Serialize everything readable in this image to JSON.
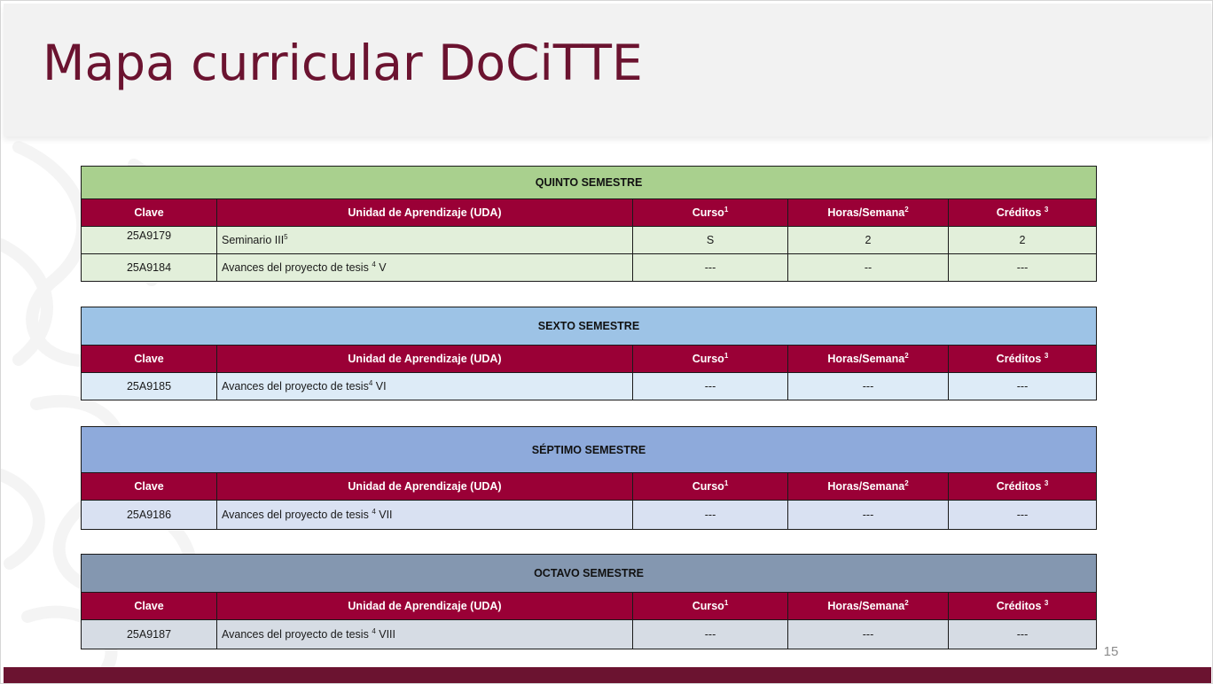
{
  "slide": {
    "title": "Mapa curricular DoCiTTE",
    "page_number": "15"
  },
  "columns": {
    "clave": "Clave",
    "uda": "Unidad de Aprendizaje (UDA)",
    "curso": "Curso",
    "curso_sup": "1",
    "horas": "Horas/Semana",
    "horas_sup": "2",
    "creditos": "Créditos ",
    "creditos_sup": "3"
  },
  "semesters": [
    {
      "title": "QUINTO SEMESTRE",
      "rows": [
        {
          "clave": "25A9179",
          "uda": "Seminario III",
          "uda_sup": "5",
          "uda_suffix": "",
          "curso": "S",
          "horas": "2",
          "creditos": "2"
        },
        {
          "clave": "25A9184",
          "uda": "Avances del proyecto de tesis ",
          "uda_sup": "4",
          "uda_suffix": " V",
          "curso": "---",
          "horas": "--",
          "creditos": "---"
        }
      ]
    },
    {
      "title": "SEXTO SEMESTRE",
      "rows": [
        {
          "clave": "25A9185",
          "uda": "Avances del proyecto de tesis",
          "uda_sup": "4",
          "uda_suffix": " VI",
          "curso": "---",
          "horas": "---",
          "creditos": "---"
        }
      ]
    },
    {
      "title": "SÉPTIMO SEMESTRE",
      "rows": [
        {
          "clave": "25A9186",
          "uda": "Avances del proyecto de tesis ",
          "uda_sup": "4",
          "uda_suffix": " VII",
          "curso": "---",
          "horas": "---",
          "creditos": "---"
        }
      ]
    },
    {
      "title": "OCTAVO SEMESTRE",
      "rows": [
        {
          "clave": "25A9187",
          "uda": "Avances del proyecto de tesis ",
          "uda_sup": "4",
          "uda_suffix": " VIII",
          "curso": "---",
          "horas": "---",
          "creditos": "---"
        }
      ]
    }
  ],
  "colors": {
    "title": "#6b1330",
    "header_row": "#9a0036",
    "footer_band": "#6b1330",
    "quinto_title": "#a9d08e",
    "quinto_rows": "#e2efda",
    "sexto_title": "#9dc3e6",
    "sexto_rows": "#ddebf7",
    "septimo_title": "#8eaadb",
    "septimo_rows": "#d9e1f2",
    "octavo_title": "#8497b0",
    "octavo_rows": "#d6dce4"
  },
  "icons": {
    "watermark": "decorative-swirl-pattern"
  }
}
